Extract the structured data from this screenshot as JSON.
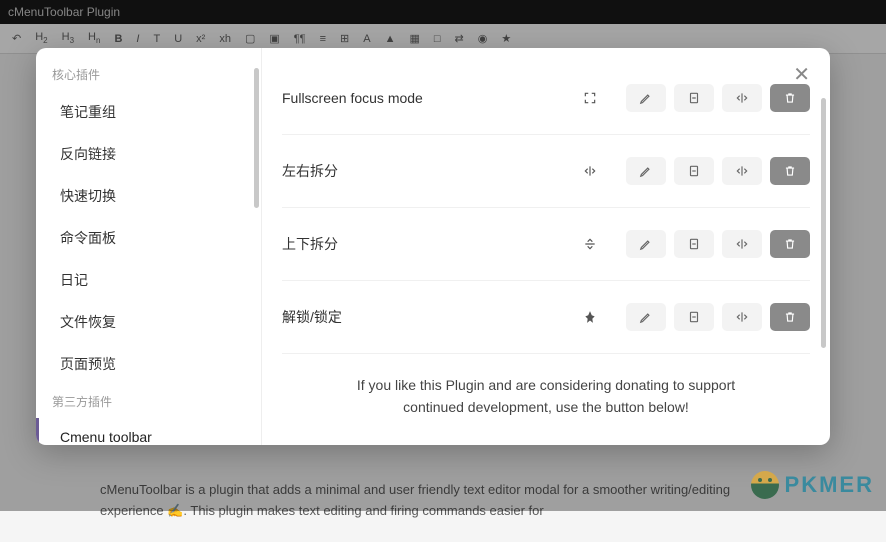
{
  "titlebar": {
    "title": "cMenuToolbar Plugin"
  },
  "toolbar_items": [
    "↶",
    "H2",
    "H3",
    "Hn",
    "B",
    "I",
    "T",
    "U",
    "x²",
    "xh",
    "▢",
    "▣",
    "¶¶",
    "≡",
    "⊞",
    "A",
    "▲",
    "▦",
    "□",
    "⇄",
    "◉",
    "★"
  ],
  "sidebar": {
    "section_core": "核心插件",
    "section_third": "第三方插件",
    "items": [
      "笔记重组",
      "反向链接",
      "快速切换",
      "命令面板",
      "日记",
      "文件恢复",
      "页面预览"
    ],
    "third_items": [
      "Cmenu toolbar"
    ]
  },
  "settings": [
    {
      "label": "Fullscreen focus mode",
      "icon": "fullscreen"
    },
    {
      "label": "左右拆分",
      "icon": "split-h"
    },
    {
      "label": "上下拆分",
      "icon": "split-v"
    },
    {
      "label": "解锁/锁定",
      "icon": "pin"
    }
  ],
  "donate": "If you like this Plugin and are considering donating to support continued development, use the button below!",
  "bg_text": "cMenuToolbar is a plugin that adds a minimal and user friendly text editor modal for a smoother writing/editing experience ✍️. This plugin makes text editing and firing commands easier for",
  "watermark": "PKMER"
}
